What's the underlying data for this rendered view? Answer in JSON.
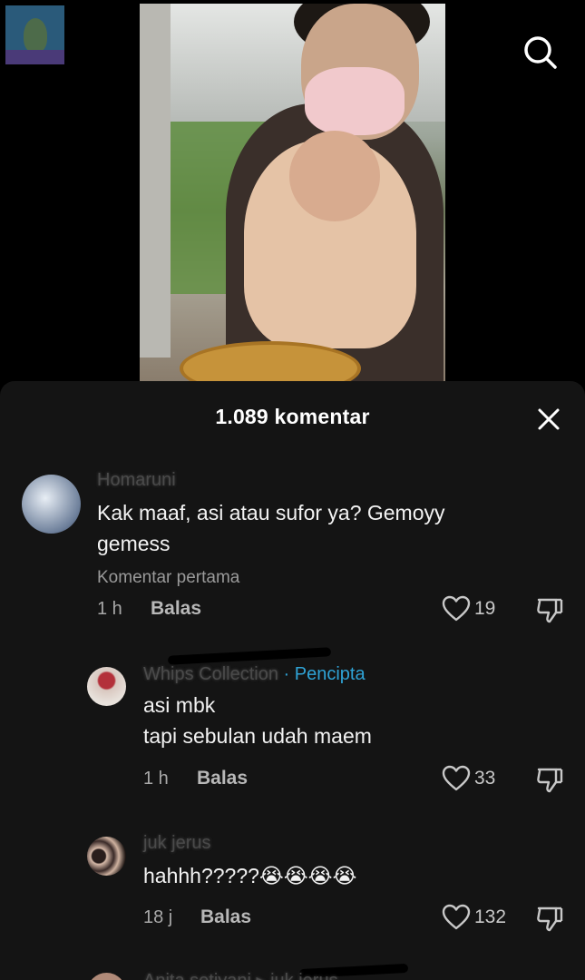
{
  "header": {
    "search_icon": "search-icon"
  },
  "sheet": {
    "title": "1.089 komentar",
    "close_icon": "close-icon"
  },
  "comments": [
    {
      "username": "Homaruni",
      "text": "Kak maaf, asi atau sufor ya? Gemoyy\ngemess",
      "label": "Komentar pertama",
      "time": "1 h",
      "reply": "Balas",
      "likes": "19"
    },
    {
      "username": "Whips Collection",
      "creator_badge": "· Pencipta",
      "text": "asi mbk\ntapi sebulan udah maem",
      "time": "1 h",
      "reply": "Balas",
      "likes": "33"
    },
    {
      "username": "juk jerus",
      "text": "hahhh?????😭😭😭😭",
      "time": "18 j",
      "reply": "Balas",
      "likes": "132"
    },
    {
      "username": "Anita setiyani ▸ juk jerus"
    }
  ]
}
